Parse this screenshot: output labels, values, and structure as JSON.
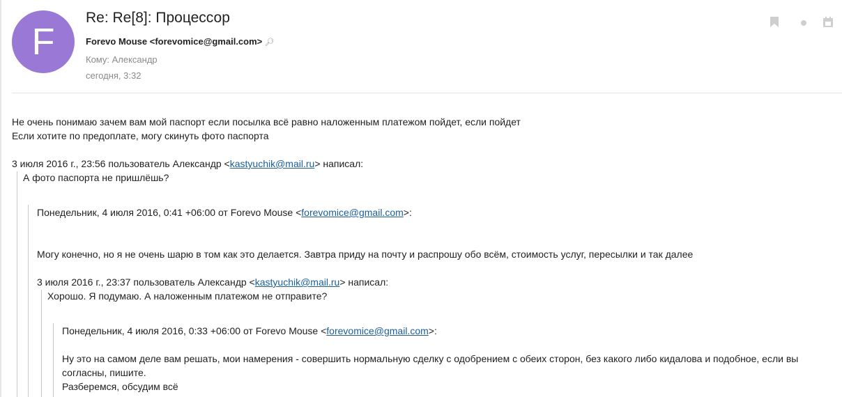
{
  "email": {
    "subject": "Re: Re[8]: Процессор",
    "sender": "Forevo Mouse <forevomice@gmail.com>",
    "recipient": "Кому: Александр",
    "date": "сегодня, 3:32",
    "avatar_letter": "F"
  },
  "icons": {
    "lookup": "search-icon",
    "bookmark": "bookmark-icon",
    "status_dot": "dot-icon",
    "calendar": "calendar-icon"
  },
  "colors": {
    "avatar": "#9a78d6",
    "link": "#1a5e9a"
  },
  "body": {
    "line1": "Не очень понимаю зачем вам мой паспорт если посылка всё равно наложенным платежом пойдет, если пойдет",
    "line2": "Если хотите по предоплате, могу скинуть фото паспорта",
    "q1_header_pre": "3 июля 2016 г., 23:56 пользователь Александр <",
    "q1_email": "kastyuchik@mail.ru",
    "q1_header_post": "> написал:",
    "q1_text": "А фото паспорта не пришлёшь?",
    "q2_header_pre": "Понедельник, 4 июля 2016, 0:41 +06:00 от Forevo Mouse <",
    "q2_email": "forevomice@gmail.com",
    "q2_header_post": ">:",
    "q2_text": "Могу конечно, но я не очень шарю в том как это делается. Завтра приду на почту и распрошу обо всём, стоимость услуг, пересылки и так далее",
    "q3_header_pre": "3 июля 2016 г., 23:37 пользователь Александр <",
    "q3_email": "kastyuchik@mail.ru",
    "q3_header_post": "> написал:",
    "q3_text": "Хорошо. Я подумаю. А наложенным платежом не отправите?",
    "q4_header_pre": "Понедельник, 4 июля 2016, 0:33 +06:00 от Forevo Mouse <",
    "q4_email": "forevomice@gmail.com",
    "q4_header_post": ">:",
    "q4_text": "Ну это на самом деле вам решать, мои намерения - совершить нормальную сделку с одобрением с обеих сторон, без какого либо кидалова и подобное, если вы согласны, пишите.",
    "q4_text2": "Разберемся, обсудим всё"
  }
}
